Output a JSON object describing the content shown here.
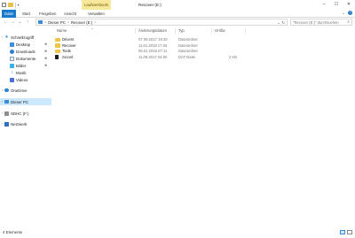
{
  "window": {
    "title": "Recover (E:)",
    "contextual_tab": "Laufwerktools",
    "controls": {
      "minimize": "–",
      "maximize": "☐",
      "close": "✕"
    }
  },
  "quick_access_toolbar": {
    "dropdown": "▾"
  },
  "ribbon": {
    "tabs": [
      "Datei",
      "Start",
      "Freigeben",
      "Ansicht",
      "Verwalten"
    ],
    "expand": "⌄",
    "help": "?"
  },
  "navigation": {
    "back": "←",
    "forward": "→",
    "recent": "⌄",
    "up": "↑",
    "breadcrumb": [
      "Dieser PC",
      "Recover (E:)"
    ],
    "separator": ">",
    "dropdown": "⌄",
    "refresh": "↻",
    "search_placeholder": "\"Recover (E:)\" durchsuchen",
    "search_icon": "⌕"
  },
  "nav_pane": {
    "items": [
      {
        "label": "Schnellzugriff",
        "icon": "star-icon",
        "pinned": false
      },
      {
        "label": "Desktop",
        "icon": "desktop-icon",
        "pinned": true
      },
      {
        "label": "Downloads",
        "icon": "download-icon",
        "pinned": true
      },
      {
        "label": "Dokumente",
        "icon": "documents-icon",
        "pinned": true
      },
      {
        "label": "Bilder",
        "icon": "pictures-icon",
        "pinned": true
      },
      {
        "label": "Musik",
        "icon": "music-icon",
        "pinned": false
      },
      {
        "label": "Videos",
        "icon": "videos-icon",
        "pinned": false
      },
      {
        "label": "OneDrive",
        "icon": "onedrive-icon",
        "pinned": false
      },
      {
        "label": "Dieser PC",
        "icon": "this-pc-icon",
        "pinned": false
      },
      {
        "label": "SDHC (F:)",
        "icon": "sd-card-icon",
        "pinned": false
      },
      {
        "label": "Netzwerk",
        "icon": "network-icon",
        "pinned": false
      }
    ],
    "pin_glyph": "✱",
    "expand_glyph": "›"
  },
  "columns": {
    "name": "Name",
    "date": "Änderungsdatum",
    "type": "Typ",
    "size": "Größe",
    "sort_glyph": "^"
  },
  "files": [
    {
      "name": "Drivers",
      "date": "07.09.2017 18:40",
      "type": "Dateiordner",
      "size": "",
      "kind": "folder"
    },
    {
      "name": "Recover",
      "date": "11.01.2018 17:34",
      "type": "Dateiordner",
      "size": "",
      "kind": "folder"
    },
    {
      "name": "Tools",
      "date": "06.01.2016 07:11",
      "type": "Dateiordner",
      "size": "",
      "kind": "folder"
    },
    {
      "name": "zxcont",
      "date": "11.09.2017 04:50",
      "type": "DAT-Datei",
      "size": "2 KB",
      "kind": "file"
    }
  ],
  "status": {
    "count": "4 Elemente"
  },
  "colors": {
    "accent": "#1979ca",
    "contextual_tab": "#f7e99b",
    "selection": "#cce8ff",
    "folder": "#f0c64a"
  }
}
